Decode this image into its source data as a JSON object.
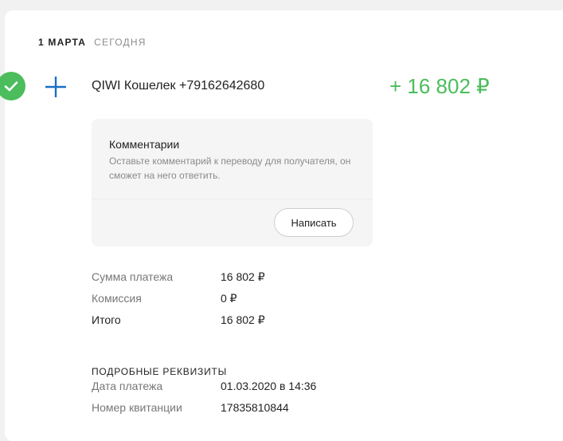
{
  "header": {
    "date": "1 марта",
    "relative": "сегодня"
  },
  "transaction": {
    "status_icon": "check-icon",
    "type_icon": "plus-icon",
    "payee": "QIWI Кошелек +79162642680",
    "amount": "+ 16 802 ₽",
    "amount_color": "#4bbd5c"
  },
  "comments": {
    "title": "Комментарии",
    "hint": "Оставьте комментарий к переводу для получателя, он сможет на него ответить.",
    "button_label": "Написать"
  },
  "summary": [
    {
      "label": "Сумма платежа",
      "value": "16 802 ₽"
    },
    {
      "label": "Комиссия",
      "value": "0 ₽"
    },
    {
      "label": "Итого",
      "value": "16 802 ₽"
    }
  ],
  "details": {
    "heading": "Подробные реквизиты",
    "rows": [
      {
        "label": "Дата платежа",
        "value": "01.03.2020 в 14:36"
      },
      {
        "label": "Номер квитанции",
        "value": "17835810844"
      }
    ]
  },
  "colors": {
    "accent_green": "#4bbd5c",
    "plus_blue": "#1a6fc4"
  }
}
